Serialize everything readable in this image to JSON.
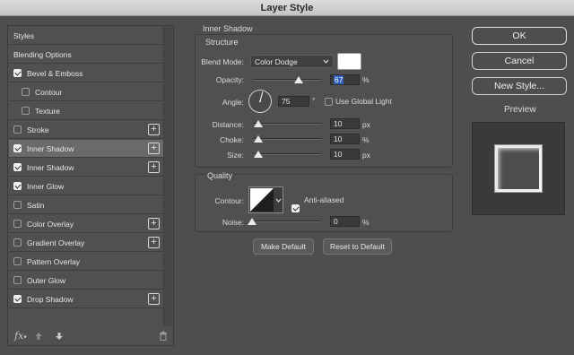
{
  "window": {
    "title": "Layer Style"
  },
  "sidebar": {
    "items": [
      {
        "label": "Styles",
        "checkbox": false,
        "plus": false
      },
      {
        "label": "Blending Options",
        "checkbox": false,
        "plus": false
      },
      {
        "label": "Bevel & Emboss",
        "checkbox": true,
        "checked": true,
        "plus": false
      },
      {
        "label": "Contour",
        "checkbox": true,
        "checked": false,
        "plus": false,
        "indent": true
      },
      {
        "label": "Texture",
        "checkbox": true,
        "checked": false,
        "plus": false,
        "indent": true
      },
      {
        "label": "Stroke",
        "checkbox": true,
        "checked": false,
        "plus": true
      },
      {
        "label": "Inner Shadow",
        "checkbox": true,
        "checked": true,
        "plus": true,
        "selected": true
      },
      {
        "label": "Inner Shadow",
        "checkbox": true,
        "checked": true,
        "plus": true
      },
      {
        "label": "Inner Glow",
        "checkbox": true,
        "checked": true,
        "plus": false
      },
      {
        "label": "Satin",
        "checkbox": true,
        "checked": false,
        "plus": false
      },
      {
        "label": "Color Overlay",
        "checkbox": true,
        "checked": false,
        "plus": true
      },
      {
        "label": "Gradient Overlay",
        "checkbox": true,
        "checked": false,
        "plus": true
      },
      {
        "label": "Pattern Overlay",
        "checkbox": true,
        "checked": false,
        "plus": false
      },
      {
        "label": "Outer Glow",
        "checkbox": true,
        "checked": false,
        "plus": false
      },
      {
        "label": "Drop Shadow",
        "checkbox": true,
        "checked": true,
        "plus": true
      }
    ],
    "fx_label": "fx",
    "plus_glyph": "+"
  },
  "inner_shadow": {
    "section_title": "Inner Shadow",
    "structure_title": "Structure",
    "blend_mode_label": "Blend Mode:",
    "blend_mode_value": "Color Dodge",
    "shadow_color": "#ffffff",
    "opacity_label": "Opacity:",
    "opacity_value": "67",
    "opacity_unit": "%",
    "opacity_level": 67,
    "angle_label": "Angle:",
    "angle_value": "75",
    "angle_unit": "°",
    "use_global_light_label": "Use Global Light",
    "use_global_light": false,
    "distance_label": "Distance:",
    "distance_value": "10",
    "distance_unit": "px",
    "choke_label": "Choke:",
    "choke_value": "10",
    "choke_unit": "%",
    "size_label": "Size:",
    "size_value": "10",
    "size_unit": "px"
  },
  "quality": {
    "title": "Quality",
    "contour_label": "Contour:",
    "anti_aliased_label": "Anti-aliased",
    "anti_aliased": true,
    "noise_label": "Noise:",
    "noise_value": "0",
    "noise_unit": "%"
  },
  "defaults": {
    "make_default_label": "Make Default",
    "reset_default_label": "Reset to Default"
  },
  "right": {
    "ok_label": "OK",
    "cancel_label": "Cancel",
    "new_style_label": "New Style...",
    "preview_label": "Preview",
    "preview_checked": true
  },
  "colors": {
    "selection": "#2f5db8",
    "panel": "#505050"
  }
}
